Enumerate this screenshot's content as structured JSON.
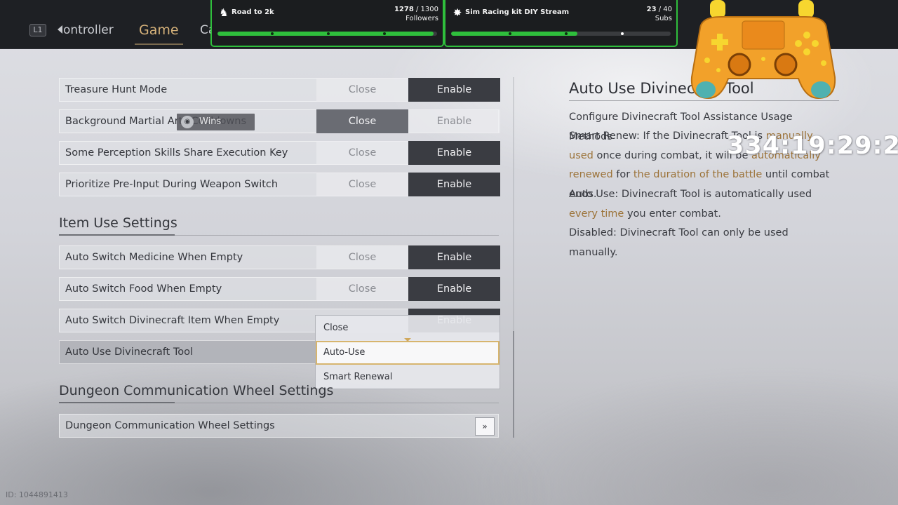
{
  "nav": {
    "l1": "L1",
    "tabs": [
      "ontroller",
      "Game",
      "Ca"
    ]
  },
  "goals": [
    {
      "icon": "paw-icon",
      "title": "Road to 2k",
      "current": "1278",
      "total": " / 1300",
      "unit": "Followers",
      "progress": 0.983
    },
    {
      "icon": "gear-icon",
      "title": "Sim Racing kit DIY Stream",
      "current": "23",
      "total": " / 40",
      "unit": "Subs",
      "progress": 0.575
    }
  ],
  "toggle_rows_top": [
    {
      "label": "Treasure Hunt Mode",
      "close": "Close",
      "enable": "Enable",
      "value": "Enable"
    },
    {
      "label": "Background Martial Arts Cooldowns",
      "close": "Close",
      "enable": "Enable",
      "value": "Close"
    },
    {
      "label": "Some Perception Skills Share Execution Key",
      "close": "Close",
      "enable": "Enable",
      "value": "Enable"
    },
    {
      "label": "Prioritize Pre-Input During Weapon Switch",
      "close": "Close",
      "enable": "Enable",
      "value": "Enable"
    }
  ],
  "tooltip_chip": "Wins",
  "item_section": {
    "title": "Item Use Settings",
    "rows": [
      {
        "label": "Auto Switch Medicine When Empty",
        "close": "Close",
        "enable": "Enable",
        "value": "Enable"
      },
      {
        "label": "Auto Switch Food When Empty",
        "close": "Close",
        "enable": "Enable",
        "value": "Enable"
      },
      {
        "label": "Auto Switch Divinecraft Item When Empty",
        "close": "Close",
        "enable": "Enable",
        "value": "Enable"
      }
    ],
    "dropdown_row": {
      "label": "Auto Use Divinecraft Tool",
      "value": "Auto-Use"
    }
  },
  "dropdown": {
    "options": [
      "Close",
      "Auto-Use",
      "Smart Renewal"
    ],
    "selected": "Auto-Use"
  },
  "dungeon_section": {
    "title": "Dungeon Communication Wheel Settings",
    "row_label": "Dungeon Communication Wheel Settings",
    "button": "»"
  },
  "info": {
    "title": "Auto Use Divinecraft Tool",
    "intro": "Configure Divinecraft Tool Assistance Usage Methods",
    "smart_a": "Smart Renew: If the Divinecraft Tool is ",
    "smart_hl1": "manually used",
    "smart_b": " once during combat, it will be ",
    "smart_hl2": "automatically renewed",
    "smart_c": " for ",
    "smart_hl3": "the duration of the battle",
    "smart_d": " until combat ends.",
    "auto_a": "Auto Use: Divinecraft Tool is automatically used ",
    "auto_hl": "every time",
    "auto_b": " you enter combat.",
    "disabled": "Disabled: Divinecraft Tool can only be used manually."
  },
  "timer": "334:19:29:22",
  "id_tag": "ID: 1044891413",
  "colors": {
    "accent_gold": "#d6b27a",
    "highlight_text": "#9c7339",
    "goal_green": "#2fbf3c",
    "controller_orange": "#f2a12a",
    "controller_yellow": "#f7d62f"
  }
}
